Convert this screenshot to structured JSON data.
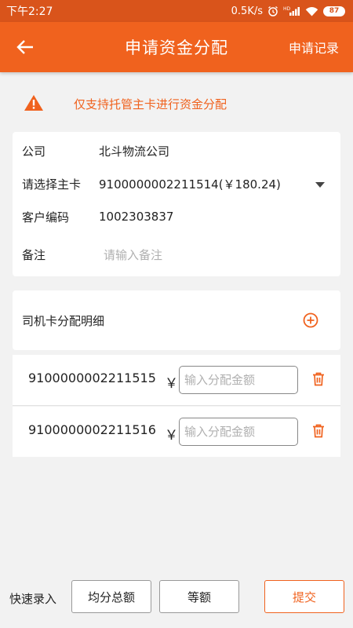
{
  "status_bar": {
    "time": "下午2:27",
    "network_speed": "0.5K/s",
    "signal_label": "HD",
    "battery": "87"
  },
  "app_bar": {
    "title": "申请资金分配",
    "action": "申请记录"
  },
  "notice": {
    "text": "仅支持托管主卡进行资金分配"
  },
  "form": {
    "company_label": "公司",
    "company_value": "北斗物流公司",
    "main_card_label": "请选择主卡",
    "main_card_value": "9100000002211514(￥180.24)",
    "customer_code_label": "客户编码",
    "customer_code_value": "1002303837",
    "remark_label": "备注",
    "remark_placeholder": "请输入备注",
    "remark_value": ""
  },
  "driver_cards": {
    "title": "司机卡分配明细",
    "currency": "￥",
    "amount_placeholder": "输入分配金额",
    "items": [
      {
        "card_no": "9100000002211515",
        "amount": ""
      },
      {
        "card_no": "9100000002211516",
        "amount": ""
      }
    ]
  },
  "footer": {
    "quick_label": "快速录入",
    "split_total": "均分总额",
    "equal_amount": "等额",
    "submit": "提交"
  },
  "colors": {
    "primary": "#f0621e",
    "status_bar": "#d9541b",
    "background": "#f2f2f2"
  }
}
